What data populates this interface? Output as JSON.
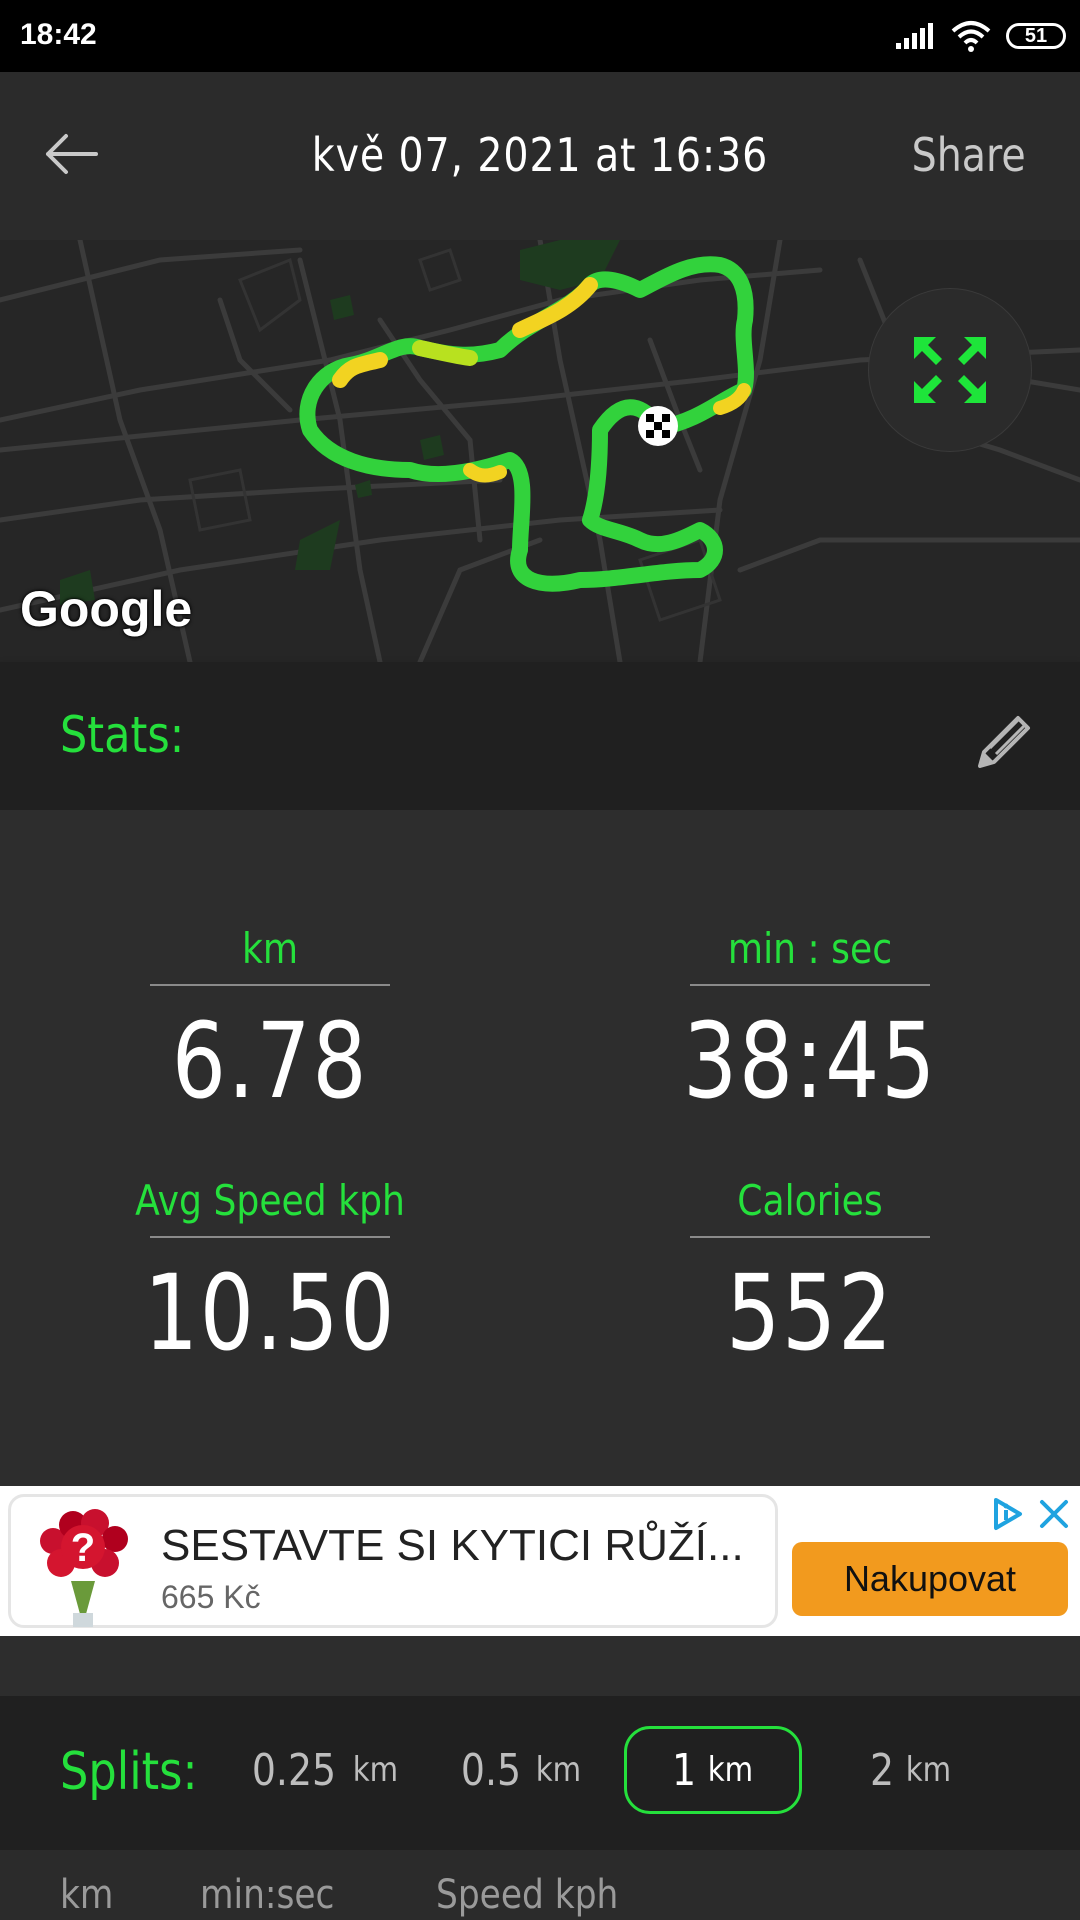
{
  "status_bar": {
    "time": "18:42",
    "battery": "51",
    "icons": [
      "signal-icon",
      "wifi-icon",
      "battery-icon"
    ]
  },
  "header": {
    "title": "kvě 07, 2021 at 16:36",
    "share_label": "Share",
    "back_icon": "back-arrow-icon"
  },
  "map": {
    "attribution": "Google",
    "expand_icon": "fullscreen-expand-icon",
    "finish_icon": "checkered-flag-icon",
    "route_colors": [
      "#32d23c",
      "#b8e11f",
      "#f2d321"
    ]
  },
  "stats": {
    "title": "Stats:",
    "edit_icon": "pencil-icon",
    "items": [
      {
        "label": "km",
        "value": "6.78"
      },
      {
        "label": "min : sec",
        "value": "38:45"
      },
      {
        "label": "Avg Speed kph",
        "value": "10.50"
      },
      {
        "label": "Calories",
        "value": "552"
      }
    ]
  },
  "ad": {
    "title": "SESTAVTE SI KYTICI RŮŽÍ...",
    "price": "665 Kč",
    "button_label": "Nakupovat",
    "image_icon": "rose-bouquet-icon",
    "choices_icon": "adchoices-icon",
    "close_icon": "close-icon"
  },
  "splits": {
    "title": "Splits:",
    "options": [
      {
        "num": "0.25",
        "unit": "km",
        "active": false
      },
      {
        "num": "0.5",
        "unit": "km",
        "active": false
      },
      {
        "num": "1",
        "unit": "km",
        "active": true
      },
      {
        "num": "2",
        "unit": "km",
        "active": false
      }
    ]
  },
  "table_header": {
    "columns": [
      "km",
      "min:sec",
      "Speed kph"
    ]
  },
  "colors": {
    "accent": "#25e03c",
    "background": "#2d2d2d",
    "header_bg": "#2b2b2b",
    "section_bg": "#202020",
    "ad_button": "#f29a1e"
  }
}
